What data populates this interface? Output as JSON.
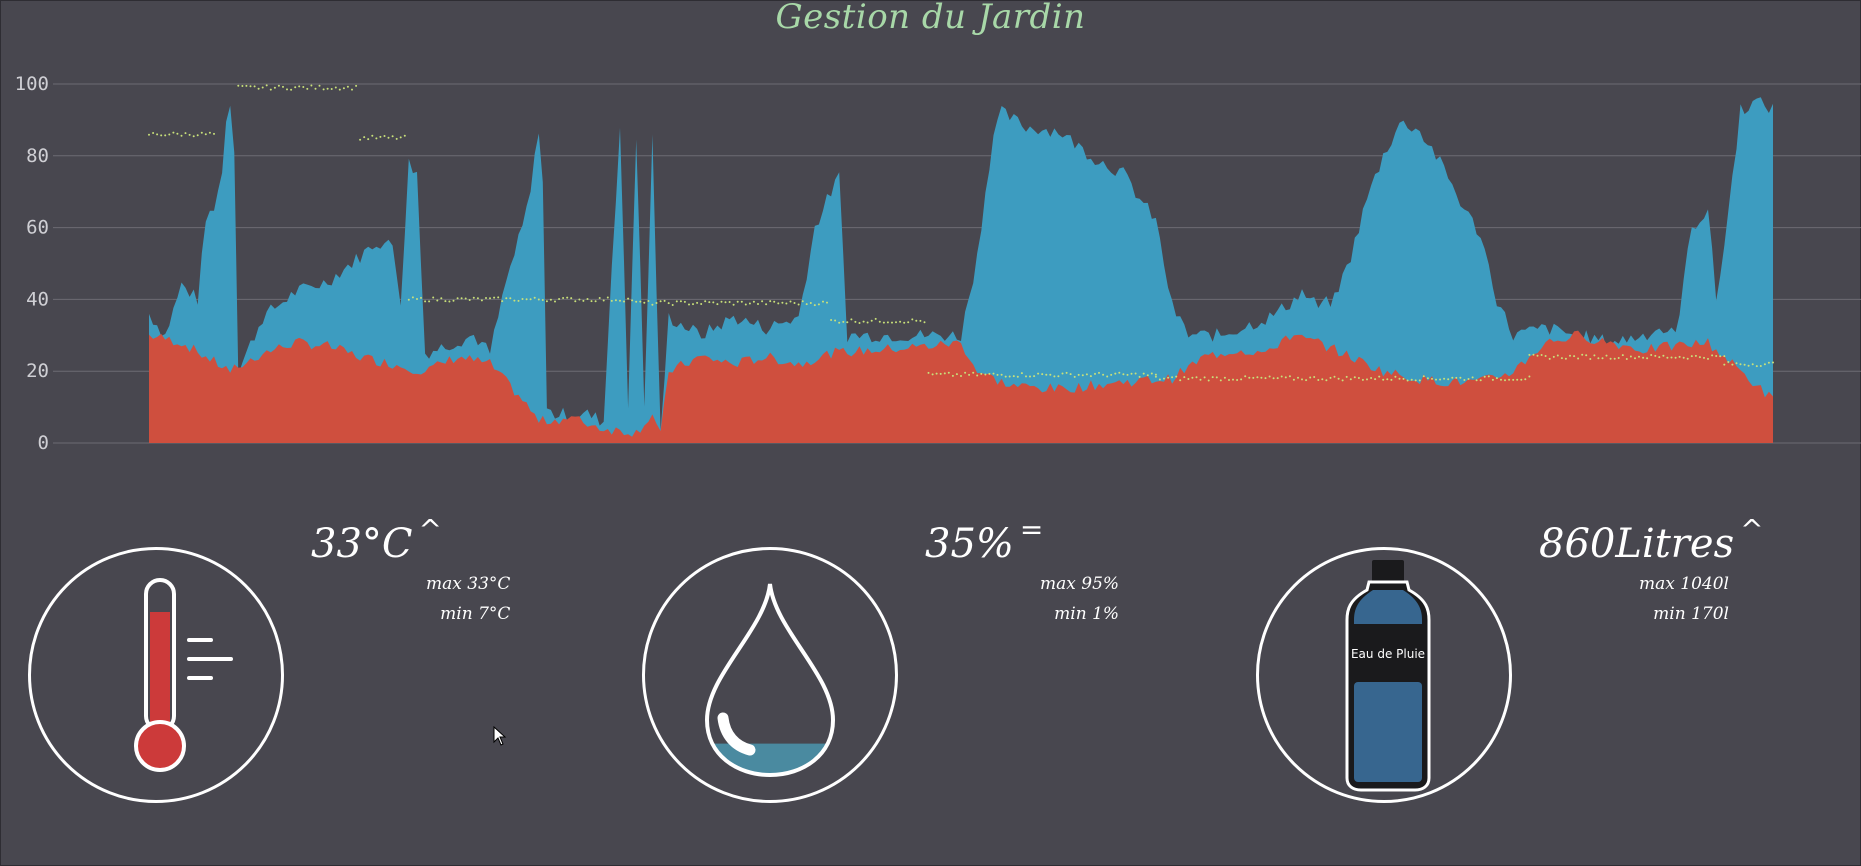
{
  "page": {
    "title": "Gestion du Jardin"
  },
  "chart_data": {
    "type": "area",
    "y_ticks": [
      "0",
      "20",
      "40",
      "60",
      "80",
      "100"
    ],
    "ylim": [
      0,
      105
    ],
    "grid": true,
    "series": [
      {
        "color": "#3d9cc0"
      },
      {
        "color": "#cf4f3e"
      },
      {
        "color": "#c8e07a"
      }
    ]
  },
  "cards": {
    "temperature": {
      "value": "33°C",
      "trend": "^",
      "max": "max 33°C",
      "min": "min 7°C",
      "icon": "thermometer-icon"
    },
    "humidity": {
      "value": "35%",
      "trend": "=",
      "max": "max 95%",
      "min": "min 1%",
      "icon": "water-drop-icon",
      "level_percent": 35
    },
    "water": {
      "value": "860Litres",
      "trend": "^",
      "max": "max 1040l",
      "min": "min 170l",
      "icon": "water-bottle-icon",
      "bottle_label": "Eau de Pluie"
    }
  },
  "colors": {
    "background": "#48474f",
    "title": "#a8d8a8",
    "humidity_area": "#3d9cc0",
    "temperature_area": "#cf4f3e",
    "level_dots": "#c8e07a",
    "thermometer": "#cc3a3a",
    "drop_water": "#4a8aa0",
    "bottle_water": "#37668f"
  }
}
